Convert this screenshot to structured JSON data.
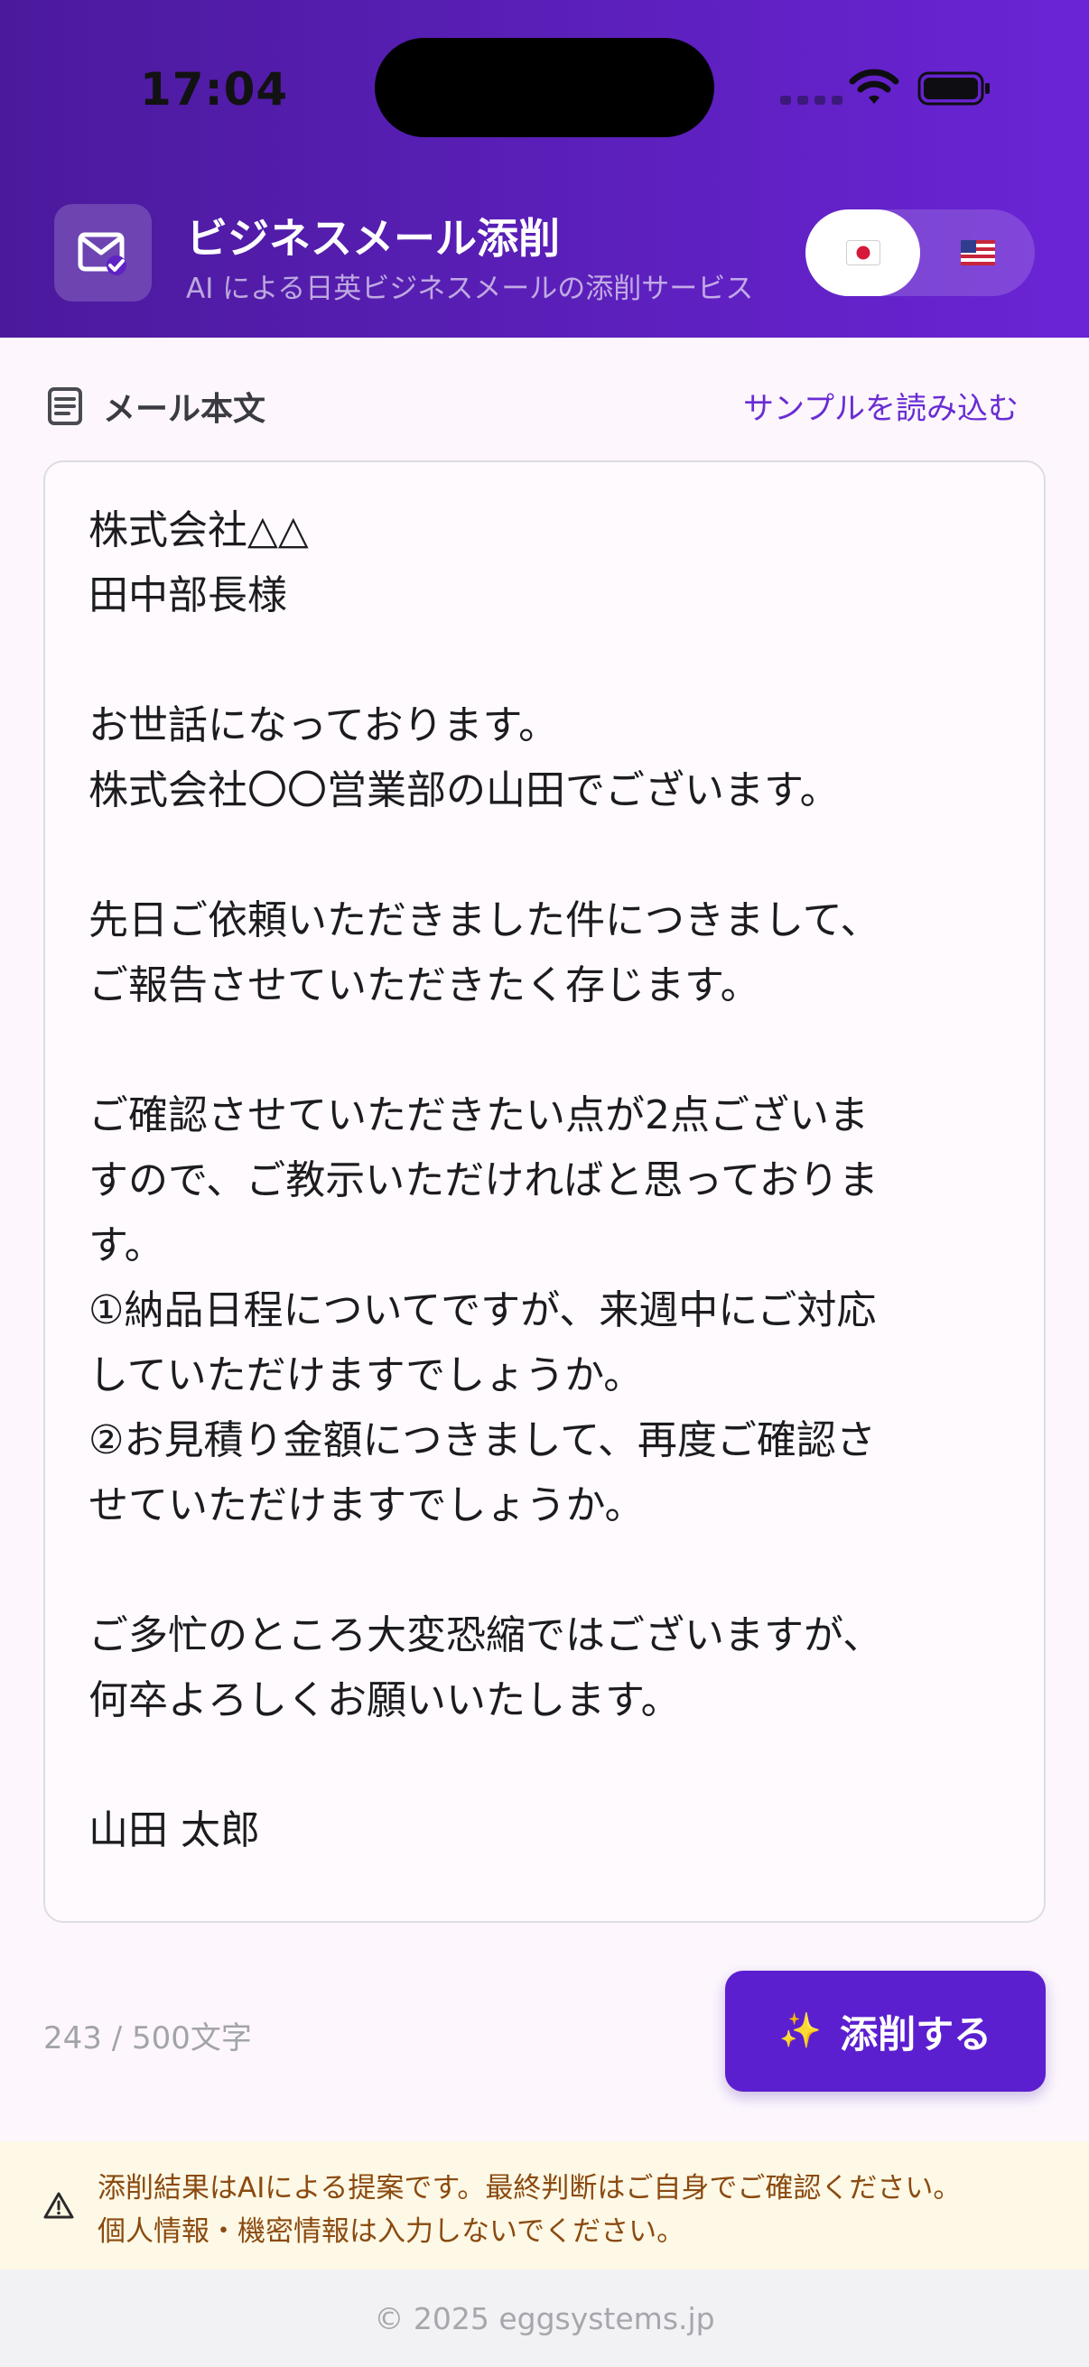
{
  "status_bar": {
    "time": "17:04"
  },
  "header": {
    "title": "ビジネスメール添削",
    "subtitle": "AI による日英ビジネスメールの添削サービス",
    "logo_icon": "mail-check-icon",
    "language_toggle": {
      "options": [
        {
          "flag": "🇯🇵",
          "icon": "japan-flag-icon",
          "selected": true
        },
        {
          "flag": "🇺🇸",
          "icon": "us-flag-icon",
          "selected": false
        }
      ]
    }
  },
  "editor": {
    "section_title": "メール本文",
    "section_icon": "document-icon",
    "sample_link": "サンプルを読み込む",
    "body": "株式会社△△\n田中部長様\n\nお世話になっております。\n株式会社〇〇営業部の山田でございます。\n\n先日ご依頼いただきました件につきまして、\nご報告させていただきたく存じます。\n\nご確認させていただきたい点が2点ございま\nすので、ご教示いただければと思っておりま\nす。\n①納品日程についてですが、来週中にご対応\nしていただけますでしょうか。\n②お見積り金額につきまして、再度ご確認さ\nせていただけますでしょうか。\n\nご多忙のところ大変恐縮ではございますが、\n何卒よろしくお願いいたします。\n\n山田 太郎",
    "char_count": "243 / 500文字",
    "submit_label": "添削する",
    "submit_icon": "✨"
  },
  "notice": {
    "icon": "warning-icon",
    "line1": "添削結果はAIによる提案です。最終判断はご自身でご確認ください。",
    "line2": "個人情報・機密情報は入力しないでください。"
  },
  "footer": {
    "text": "© 2025 eggsystems.jp"
  },
  "colors": {
    "primary": "#5b1fd0",
    "header_gradient_start": "#4b1a9c",
    "header_gradient_end": "#6b24d6",
    "notice_bg": "#fdf9e6",
    "notice_text": "#8b4a10"
  }
}
